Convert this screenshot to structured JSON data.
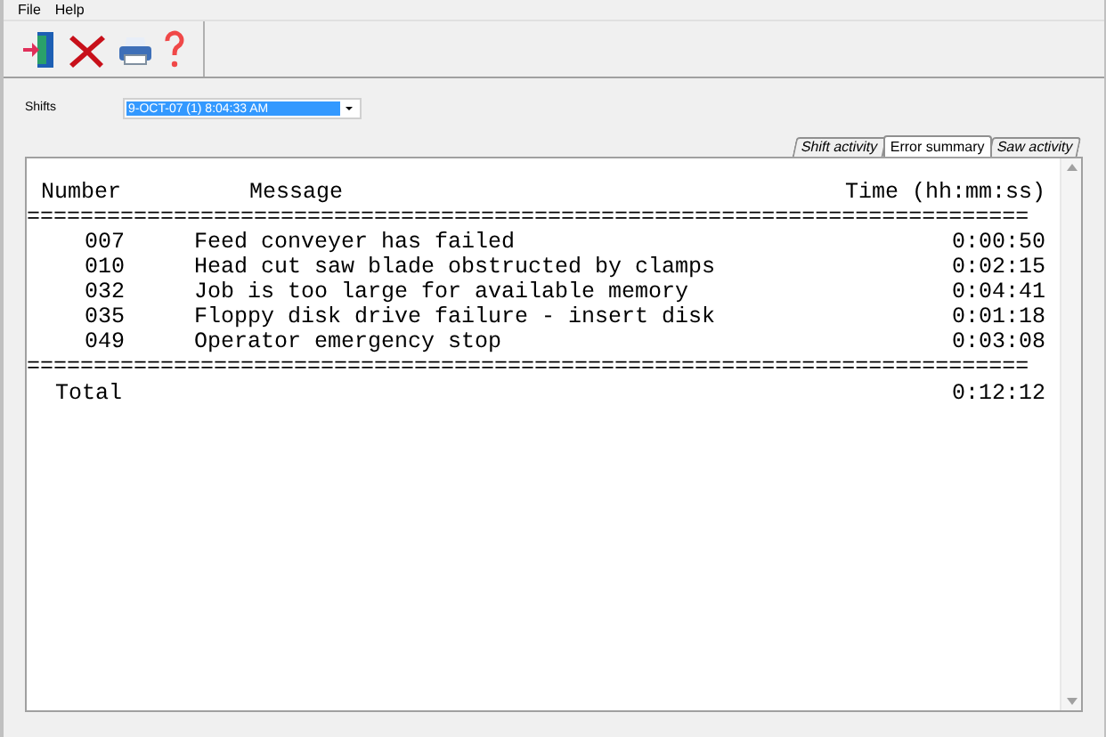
{
  "menu": [
    "File",
    "Help"
  ],
  "shifts": {
    "label": "Shifts",
    "value": "9-OCT-07 (1) 8:04:33 AM"
  },
  "tabs": [
    {
      "label": "Shift activity",
      "selected": false
    },
    {
      "label": "Error summary",
      "selected": true
    },
    {
      "label": "Saw activity",
      "selected": false
    }
  ],
  "report": {
    "headers": [
      "Number",
      "Message",
      "Time (hh:mm:ss)"
    ],
    "separator": "===========================================================================",
    "rows": [
      {
        "number": "007",
        "message": "Feed conveyer has failed",
        "time": "0:00:50"
      },
      {
        "number": "010",
        "message": "Head cut saw blade obstructed by clamps",
        "time": "0:02:15"
      },
      {
        "number": "032",
        "message": "Job is too large for available memory",
        "time": "0:04:41"
      },
      {
        "number": "035",
        "message": "Floppy disk drive failure - insert disk",
        "time": "0:01:18"
      },
      {
        "number": "049",
        "message": "Operator emergency stop",
        "time": "0:03:08"
      }
    ],
    "total": {
      "label": "Total",
      "time": "0:12:12"
    }
  }
}
